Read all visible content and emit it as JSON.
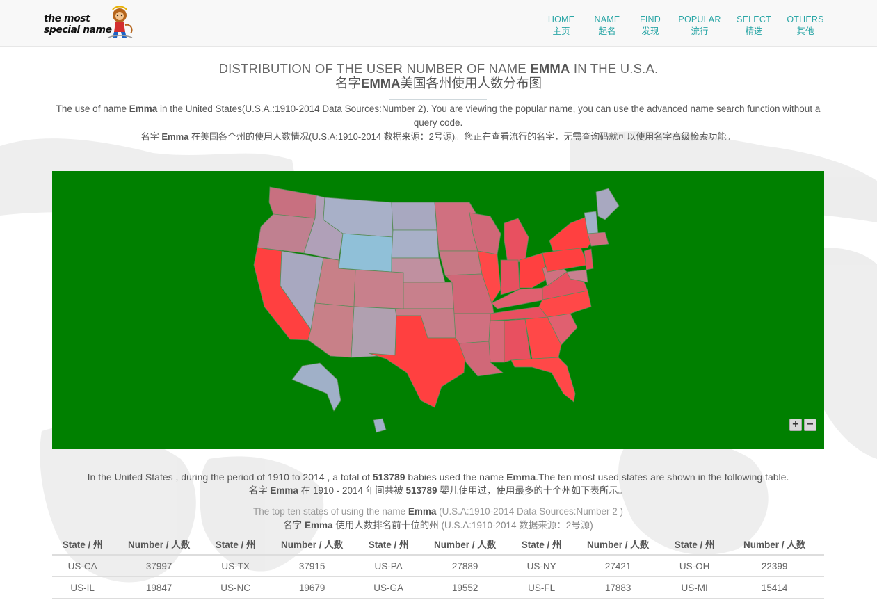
{
  "logo": {
    "line1": "the most",
    "line2": "special name"
  },
  "nav": [
    {
      "en": "HOME",
      "zh": "主页"
    },
    {
      "en": "NAME",
      "zh": "起名"
    },
    {
      "en": "FIND",
      "zh": "发现"
    },
    {
      "en": "POPULAR",
      "zh": "流行"
    },
    {
      "en": "SELECT",
      "zh": "精选"
    },
    {
      "en": "OTHERS",
      "zh": "其他"
    }
  ],
  "title": {
    "prefix": "DISTRIBUTION OF THE USER NUMBER OF NAME ",
    "name": "EMMA",
    "suffix": " IN THE U.S.A.",
    "zh_prefix": "名字",
    "zh_name": "EMMA",
    "zh_suffix": "美国各州使用人数分布图"
  },
  "intro": {
    "prefix": "The use of name ",
    "name": "Emma",
    "suffix": " in the United States(U.S.A.:1910-2014 Data Sources:Number 2). You are viewing the popular name, you can use the advanced name search function without a query code.",
    "zh_prefix": "名字 ",
    "zh_name": "Emma",
    "zh_suffix": " 在美国各个州的使用人数情况(U.S.A:1910-2014 数据来源：2号源)。您正在查看流行的名字，无需查询码就可以使用名字高级检索功能。"
  },
  "map": {
    "background": "#008000",
    "zoom_in": "+",
    "zoom_out": "−",
    "colors": {
      "high": "#ff4040",
      "mid": "#d07080",
      "low": "#a0a8c0",
      "lowest": "#90c0d8"
    }
  },
  "summary": {
    "p1": "In the United States , during the period of 1910 to 2014 , a total of ",
    "total": "513789",
    "p2": " babies used the name ",
    "name": "Emma",
    "p3": ".The ten most used states are shown in the following table.",
    "zh_p1": "名字 ",
    "zh_name": "Emma",
    "zh_p2": " 在 1910 - 2014 年间共被 ",
    "zh_total": "513789",
    "zh_p3": " 婴儿使用过，使用最多的十个州如下表所示。"
  },
  "caption": {
    "p1": "The top ten states of using the name ",
    "name": "Emma",
    "p2": " (U.S.A:1910-2014 Data Sources:Number 2 )",
    "zh_p1": "名字 ",
    "zh_name": "Emma",
    "zh_p2": " 使用人数排名前十位的州",
    "zh_p3": " (U.S.A:1910-2014 数据来源：2号源)"
  },
  "table": {
    "state_header": "State / 州",
    "number_header": "Number / 人数",
    "rows": [
      [
        [
          "US-CA",
          "37997"
        ],
        [
          "US-TX",
          "37915"
        ],
        [
          "US-PA",
          "27889"
        ],
        [
          "US-NY",
          "27421"
        ],
        [
          "US-OH",
          "22399"
        ]
      ],
      [
        [
          "US-IL",
          "19847"
        ],
        [
          "US-NC",
          "19679"
        ],
        [
          "US-GA",
          "19552"
        ],
        [
          "US-FL",
          "17883"
        ],
        [
          "US-MI",
          "15414"
        ]
      ]
    ]
  }
}
